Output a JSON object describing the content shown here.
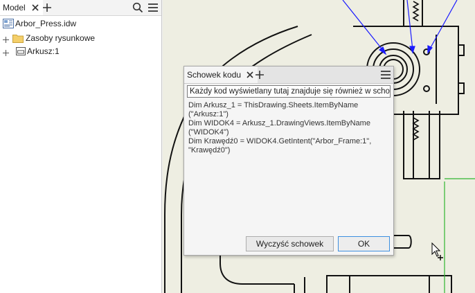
{
  "browser": {
    "tab_label": "Model",
    "tree": [
      {
        "label": "Arbor_Press.idw"
      },
      {
        "label": "Zasoby rysunkowe"
      },
      {
        "label": "Arkusz:1"
      }
    ]
  },
  "dialog": {
    "tab_label": "Schowek kodu",
    "info_text": "Każdy kod wyświetlany tutaj znajduje się również w schowku.",
    "code_lines": [
      "Dim Arkusz_1 = ThisDrawing.Sheets.ItemByName",
      "(\"Arkusz:1\")",
      "Dim WIDOK4 = Arkusz_1.DrawingViews.ItemByName",
      "(\"WIDOK4\")",
      "Dim Krawędź0 = WIDOK4.GetIntent(\"Arbor_Frame:1\",",
      "\"Krawędź0\")"
    ],
    "clear_button": "Wyczyść schowek",
    "ok_button": "OK"
  },
  "colors": {
    "canvas_bg": "#eeeee2",
    "leader_arrow": "#1a1aff",
    "accent_green": "#2fb52f",
    "ok_border": "#3c8fe0"
  },
  "icons": [
    "close-icon",
    "plus-icon",
    "search-icon",
    "menu-icon",
    "drawing-file-icon",
    "folder-icon",
    "sheet-icon",
    "cursor-icon"
  ]
}
